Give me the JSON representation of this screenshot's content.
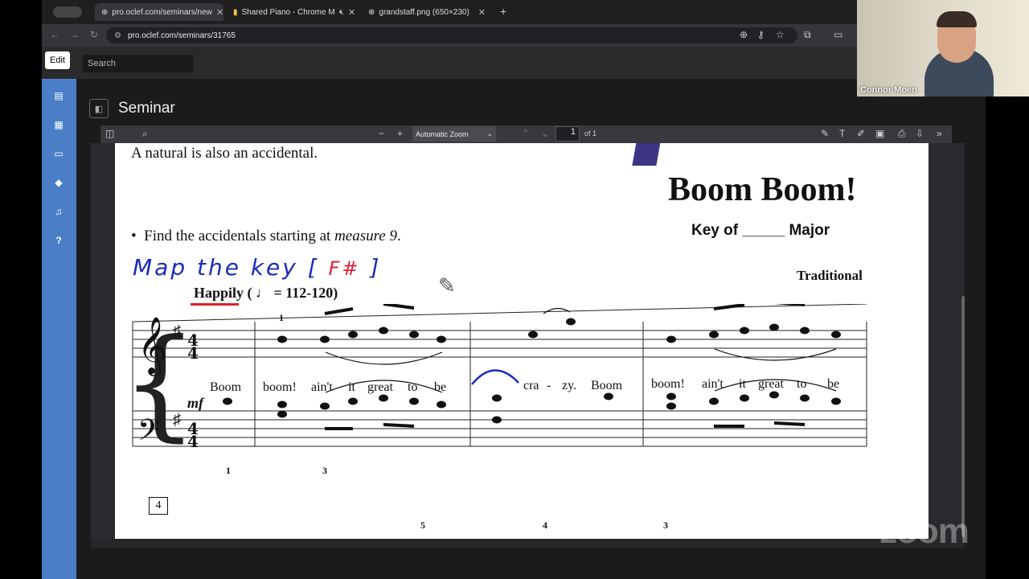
{
  "browser": {
    "tabs": [
      {
        "title": "pro.oclef.com/seminars/new",
        "active": true
      },
      {
        "title": "Shared Piano - Chrome M",
        "active": false
      },
      {
        "title": "grandstaff.png (650×230)",
        "active": false
      }
    ],
    "url": "pro.oclef.com/seminars/31765"
  },
  "app": {
    "edit_tooltip": "Edit",
    "search_placeholder": "Search",
    "title": "Seminar",
    "sidebar_icons": [
      "list-icon",
      "calendar-icon",
      "monitor-icon",
      "graduation-cap-icon",
      "music-note-icon",
      "help-icon"
    ],
    "help_glyph": "?"
  },
  "pdf_toolbar": {
    "zoom": "Automatic Zoom",
    "page": "1",
    "page_count": "of 1"
  },
  "sheet": {
    "line1": "A natural is also an accidental.",
    "bullet": "•",
    "instruction_prefix": "Find the accidentals starting at",
    "instruction_em": "measure 9",
    "instruction_suffix": ".",
    "song_title": "Boom Boom!",
    "key_line": "Key of _____ Major",
    "composer": "Traditional",
    "tempo_word": "Happily",
    "tempo_rest": "( ♩ = 112-120)",
    "handwriting": "Map the key",
    "handwriting_bracket_open": "[",
    "handwriting_note": "F#",
    "handwriting_bracket_close": "]",
    "dynamic": "mf",
    "lyrics": [
      "Boom",
      "boom!",
      "ain't",
      "it",
      "great",
      "to",
      "be",
      "cra",
      "-",
      "zy.",
      "Boom",
      "boom!",
      "ain't",
      "it",
      "great",
      "to",
      "be"
    ],
    "finger_numbers": [
      "1",
      "1",
      "3",
      "5",
      "4",
      "3"
    ],
    "measure_box": "4"
  },
  "webcam": {
    "name": "Connor Moen"
  },
  "watermark": "zoom"
}
